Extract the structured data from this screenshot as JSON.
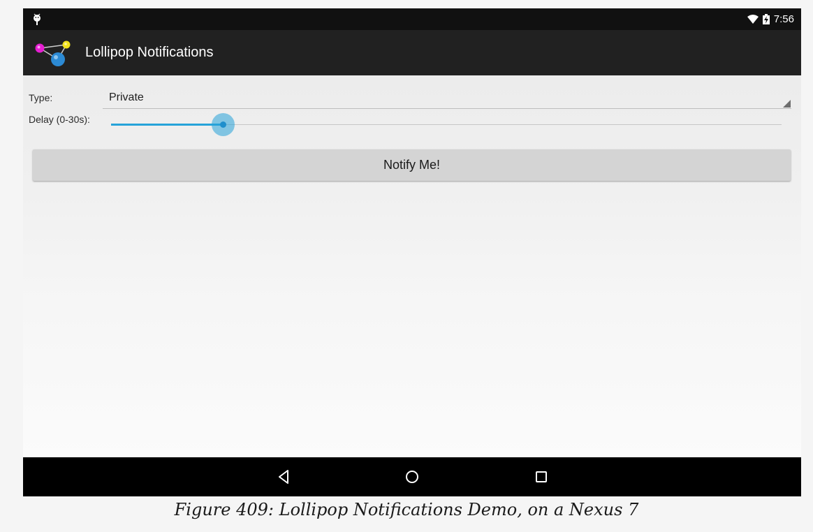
{
  "status_bar": {
    "time": "7:56",
    "left_icon": "android-debug-icon",
    "right_icons": [
      "wifi-icon",
      "battery-charging-icon"
    ]
  },
  "action_bar": {
    "title": "Lollipop Notifications",
    "icon": "app-molecule-icon"
  },
  "form": {
    "type_label": "Type:",
    "type_value": "Private",
    "delay_label": "Delay (0-30s):",
    "delay_value_fraction": 0.167,
    "notify_button": "Notify Me!"
  },
  "nav_bar": {
    "icons": [
      "back-icon",
      "home-icon",
      "recents-icon"
    ]
  },
  "caption": "Figure 409: Lollipop Notifications Demo, on a Nexus 7",
  "colors": {
    "accent": "#26a3d9",
    "action_bar": "#212121",
    "status_bar": "#111111",
    "nav_bar": "#000000"
  }
}
